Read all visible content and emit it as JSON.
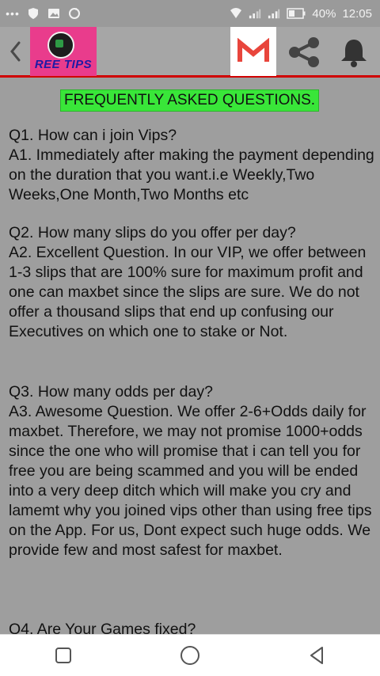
{
  "status_bar": {
    "battery": "40%",
    "time": "12:05",
    "left_icons": [
      "more-icon",
      "shield-icon",
      "image-icon",
      "sync-icon"
    ],
    "right_icons": [
      "wifi-icon",
      "signal-icon",
      "signal-icon",
      "battery-icon"
    ]
  },
  "app_bar": {
    "logo_text": "REE TIPS",
    "icons": [
      "back-icon",
      "gmail-icon",
      "share-icon",
      "bell-icon"
    ],
    "accent_color": "#d00000"
  },
  "faq": {
    "title": "FREQUENTLY ASKED QUESTIONS.",
    "items": [
      {
        "question": "Q1. How can i join Vips?",
        "answer": "A1. Immediately after making the payment depending on the duration that you want.i.e Weekly,Two Weeks,One Month,Two Months etc"
      },
      {
        "question": "Q2. How many slips do you offer per day?",
        "answer": "A2. Excellent Question. In our VIP, we offer between 1-3 slips that are 100% sure for maximum profit and one can maxbet since the slips are sure. We do not offer a thousand slips that end up confusing our Executives on which one to stake or Not."
      },
      {
        "question": "Q3. How many odds per day?",
        "answer": "A3. Awesome Question. We offer 2-6+Odds daily for maxbet. Therefore, we may not promise 1000+odds since the one who will promise that i can tell you for free you are being scammed and you will be ended into a very deep ditch which will make you cry and lamemt why you joined vips other than using free tips on the App. For us, Dont expect such huge odds. We provide few and most safest for maxbet."
      },
      {
        "question": "Q4. Are Your Games fixed?",
        "answer": ""
      }
    ]
  },
  "nav_bar": {
    "icons": [
      "recents-icon",
      "home-icon",
      "back-triangle-icon"
    ]
  }
}
